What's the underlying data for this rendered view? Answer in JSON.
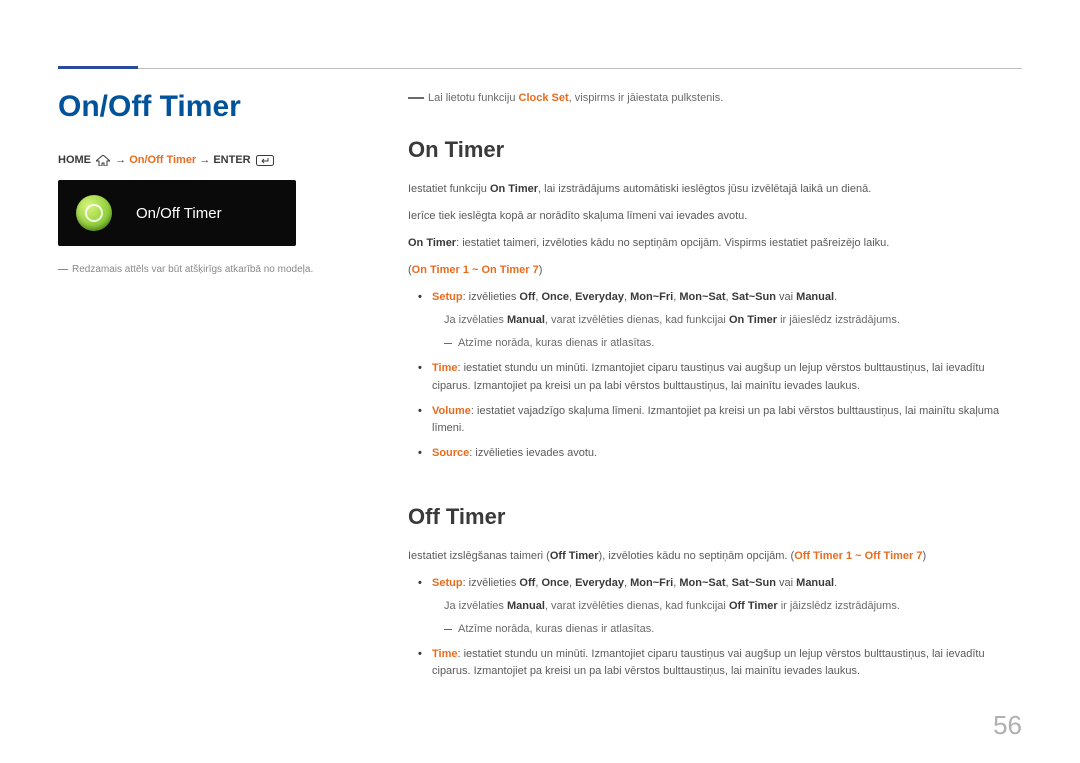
{
  "pageNumber": "56",
  "left": {
    "title": "On/Off Timer",
    "breadcrumb": {
      "home": "HOME",
      "path": "On/Off Timer",
      "enter": "ENTER"
    },
    "tile": {
      "iconName": "timer-clock-icon",
      "label": "On/Off Timer"
    },
    "note": "Redzamais attēls var būt atšķirīgs atkarībā no modeļa."
  },
  "right": {
    "leadNote_pre": "Lai lietotu funkciju ",
    "leadNote_bold": "Clock Set",
    "leadNote_post": ", vispirms ir jāiestata pulkstenis.",
    "onTimer": {
      "title": "On Timer",
      "intro_pre": "Iestatiet funkciju ",
      "intro_bold": "On Timer",
      "intro_post": ", lai izstrādājums automātiski ieslēgtos jūsu izvēlētajā laikā un dienā.",
      "p2": "Ierīce tiek ieslēgta kopā ar norādīto skaļuma līmeni vai ievades avotu.",
      "p3_bold": "On Timer",
      "p3_post": ": iestatiet taimeri, izvēloties kādu no septiņām opcijām. Vispirms iestatiet pašreizējo laiku.",
      "range": "On Timer 1 ~ On Timer 7",
      "bullets": {
        "setup_label": "Setup",
        "setup_text_pre": ": izvēlieties ",
        "setup_opts": [
          "Off",
          "Once",
          "Everyday",
          "Mon~Fri",
          "Mon~Sat",
          "Sat~Sun"
        ],
        "setup_or": " vai ",
        "setup_manual": "Manual",
        "setup_sub_pre": "Ja izvēlaties ",
        "setup_sub_bold1": "Manual",
        "setup_sub_mid": ", varat izvēlēties dienas, kad funkcijai ",
        "setup_sub_bold2": "On Timer",
        "setup_sub_post": " ir jāieslēdz izstrādājums.",
        "setup_dash": "Atzīme norāda, kuras dienas ir atlasītas.",
        "time_label": "Time",
        "time_text": ": iestatiet stundu un minūti. Izmantojiet ciparu taustiņus vai augšup un lejup vērstos bulttaustiņus, lai ievadītu ciparus. Izmantojiet pa kreisi un pa labi vērstos bulttaustiņus, lai mainītu ievades laukus.",
        "volume_label": "Volume",
        "volume_text": ": iestatiet vajadzīgo skaļuma līmeni. Izmantojiet pa kreisi un pa labi vērstos bulttaustiņus, lai mainītu skaļuma līmeni.",
        "source_label": "Source",
        "source_text": ": izvēlieties ievades avotu."
      }
    },
    "offTimer": {
      "title": "Off Timer",
      "intro_pre": "Iestatiet izslēgšanas taimeri (",
      "intro_bold": "Off Timer",
      "intro_post": "), izvēloties kādu no septiņām opcijām. (",
      "range": "Off Timer 1 ~ Off Timer 7",
      "intro_close": ")",
      "bullets": {
        "setup_label": "Setup",
        "setup_text_pre": ": izvēlieties ",
        "setup_opts": [
          "Off",
          "Once",
          "Everyday",
          "Mon~Fri",
          "Mon~Sat",
          "Sat~Sun"
        ],
        "setup_or": " vai ",
        "setup_manual": "Manual",
        "setup_sub_pre": "Ja izvēlaties ",
        "setup_sub_bold1": "Manual",
        "setup_sub_mid": ", varat izvēlēties dienas, kad funkcijai ",
        "setup_sub_bold2": "Off Timer",
        "setup_sub_post": " ir jāizslēdz izstrādājums.",
        "setup_dash": "Atzīme norāda, kuras dienas ir atlasītas.",
        "time_label": "Time",
        "time_text": ": iestatiet stundu un minūti. Izmantojiet ciparu taustiņus vai augšup un lejup vērstos bulttaustiņus, lai ievadītu ciparus. Izmantojiet pa kreisi un pa labi vērstos bulttaustiņus, lai mainītu ievades laukus."
      }
    }
  }
}
